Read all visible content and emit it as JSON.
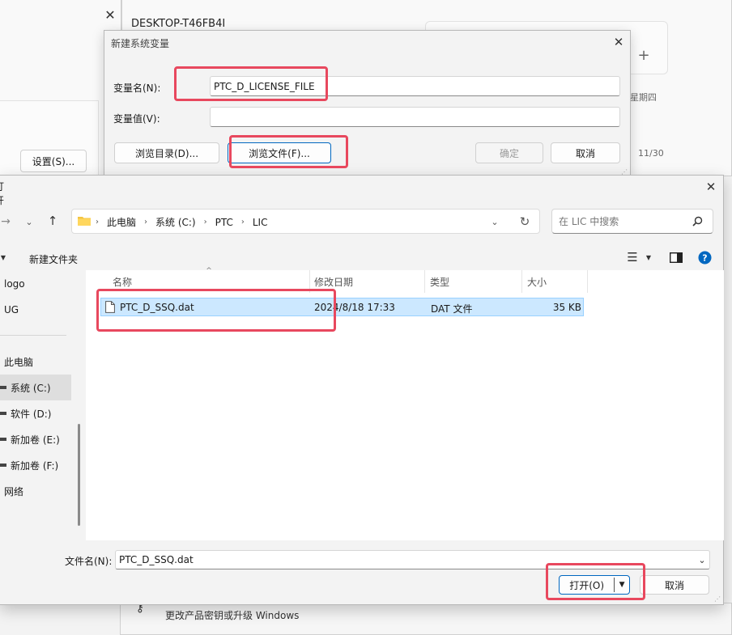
{
  "bg": {
    "hostname": "DESKTOP-T46FB4I",
    "weekday": "星期四",
    "date": "11/30",
    "settings_button": "设置(S)...",
    "product_key_text": "更改产品密钥或升级 Windows"
  },
  "new_var_dialog": {
    "title": "新建系统变量",
    "name_label": "变量名(N):",
    "name_value": "PTC_D_LICENSE_FILE",
    "value_label": "变量值(V):",
    "value_value": "",
    "browse_dir": "浏览目录(D)...",
    "browse_file": "浏览文件(F)...",
    "ok": "确定",
    "cancel": "取消"
  },
  "file_dialog": {
    "title": "打开",
    "breadcrumb": [
      "此电脑",
      "系统 (C:)",
      "PTC",
      "LIC"
    ],
    "search_placeholder": "在 LIC 中搜索",
    "new_folder": "新建文件夹",
    "nav": [
      "logo",
      "UG",
      "此电脑",
      "系统 (C:)",
      "软件 (D:)",
      "新加卷 (E:)",
      "新加卷 (F:)",
      "网络"
    ],
    "columns": [
      "名称",
      "修改日期",
      "类型",
      "大小"
    ],
    "files": [
      {
        "name": "PTC_D_SSQ.dat",
        "date": "2024/8/18 17:33",
        "type": "DAT 文件",
        "size": "35 KB"
      }
    ],
    "filename_label": "文件名(N):",
    "filename_value": "PTC_D_SSQ.dat",
    "open": "打开(O)",
    "cancel": "取消"
  },
  "colors": {
    "highlight": "#e8485e",
    "selection": "#cce8ff",
    "accent": "#0067c0",
    "folder": "#f4c542"
  }
}
